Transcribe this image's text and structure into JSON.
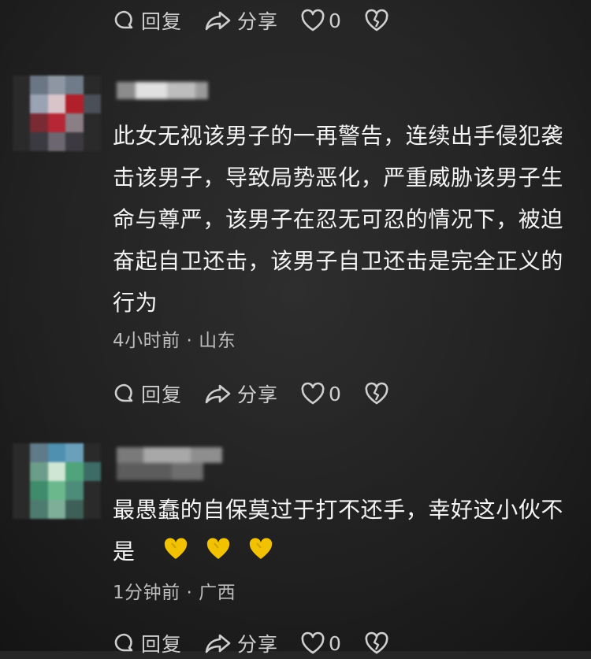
{
  "actions": {
    "reply_label": "回复",
    "share_label": "分享",
    "like_count": "0"
  },
  "comments": [
    {
      "text": "此女无视该男子的一再警告，连续出手侵犯袭击该男子，导致局势恶化，严重威胁该男子生命与尊严，该男子在忍无可忍的情况下，被迫奋起自卫还击，该男子自卫还击是完全正义的行为",
      "time": "4小时前",
      "separator": "·",
      "location": "山东"
    },
    {
      "text": "最愚蠢的自保莫过于打不还手，幸好这小伙不是",
      "emojis": [
        "yellow-heart-emoji",
        "yellow-heart-emoji",
        "yellow-heart-emoji"
      ],
      "time": "1分钟前",
      "separator": "·",
      "location": "广西"
    }
  ],
  "colors": {
    "background": "#232323",
    "text": "#f4f4f4",
    "meta": "#bdbdbd",
    "icon": "#cfcfcf",
    "emoji": "#f2c200"
  }
}
